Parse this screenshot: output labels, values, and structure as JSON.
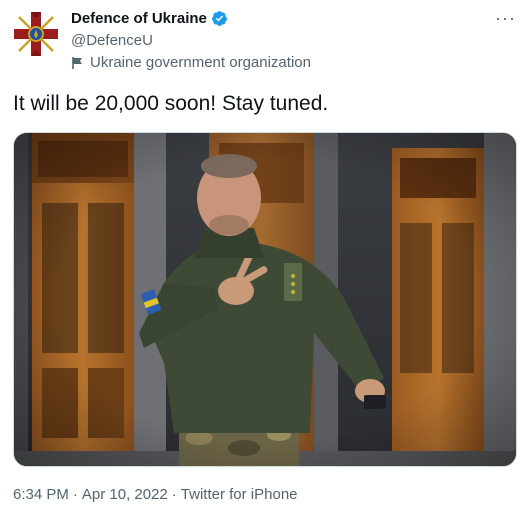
{
  "account": {
    "name": "Defence of Ukraine",
    "handle": "@DefenceU",
    "affiliation": "Ukraine government organization",
    "verified_icon": "verified-badge-icon",
    "avatar_icon": "ministry-of-defence-emblem-icon"
  },
  "more_label": "···",
  "tweet": {
    "text": "It will be 20,000 soon! Stay tuned."
  },
  "photo": {
    "subject": "photo"
  },
  "meta": {
    "time": "6:34 PM",
    "sep1": "·",
    "date": "Apr 10, 2022",
    "sep2": "·",
    "source": "Twitter for iPhone"
  },
  "colors": {
    "text": "#0f1419",
    "secondary": "#536471",
    "verified": "#1d9bf0",
    "avatar_red": "#9b1c1c",
    "avatar_gold": "#c9a227"
  }
}
